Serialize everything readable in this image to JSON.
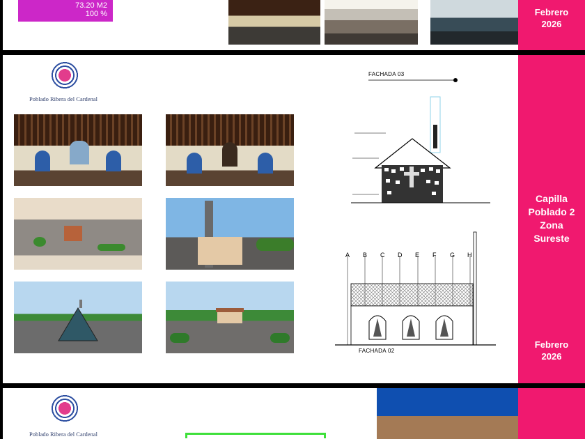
{
  "top_panel": {
    "area_label": "73.20 M2",
    "percent_label": "100 %",
    "date_label": "Febrero 2026",
    "accent_color": "#cc27c8"
  },
  "middle_panel": {
    "logo_text": "Poblado Ribera del Cardenal",
    "drawing_top_title": "FACHADA 03",
    "drawing_bottom_title": "FACHADA 02",
    "axis_letters": [
      "A",
      "B",
      "C",
      "D",
      "E",
      "F",
      "G",
      "H"
    ],
    "side_title_lines": [
      "Capilla",
      "Poblado 2",
      "Zona",
      "Sureste"
    ],
    "date_label": "Febrero 2026"
  },
  "bottom_panel": {
    "logo_text": "Poblado Ribera del Cardenal"
  },
  "colors": {
    "side_band": "#f0196f",
    "logo_blue": "#2d4fa1",
    "logo_pink": "#e23c8c"
  }
}
